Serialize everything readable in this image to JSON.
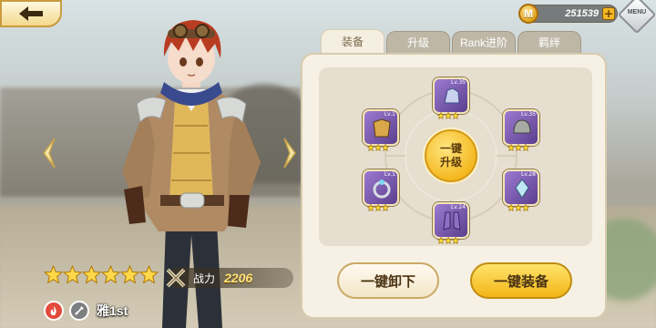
{
  "header": {
    "currency": {
      "icon_letter": "M",
      "value": "251539"
    },
    "menu_label": "MENU"
  },
  "tabs": [
    {
      "label": "装备",
      "active": true
    },
    {
      "label": "升级",
      "active": false
    },
    {
      "label": "Rank进阶",
      "active": false
    },
    {
      "label": "羁绊",
      "active": false
    }
  ],
  "character": {
    "name": "雅1st",
    "stars": 6,
    "power_label": "战力",
    "power_value": "2206",
    "element_icon": "fire-icon",
    "class_icon": "sword-icon"
  },
  "equipment": [
    {
      "slot": "top",
      "level": "Lv.35",
      "stars": 3
    },
    {
      "slot": "upper-left",
      "level": "Lv.1",
      "stars": 3
    },
    {
      "slot": "upper-right",
      "level": "Lv.35",
      "stars": 3
    },
    {
      "slot": "lower-left",
      "level": "Lv.1",
      "stars": 3
    },
    {
      "slot": "lower-right",
      "level": "Lv.28",
      "stars": 3
    },
    {
      "slot": "bottom",
      "level": "Lv.24",
      "stars": 3
    }
  ],
  "upgrade_button": {
    "line1": "一键",
    "line2": "升级"
  },
  "actions": {
    "unload_all": "一键卸下",
    "equip_all": "一键装备"
  },
  "colors": {
    "panel_bg": "#f6f1e4",
    "accent_gold": "#f2b517",
    "slot_purple": "#7b5bb3"
  }
}
